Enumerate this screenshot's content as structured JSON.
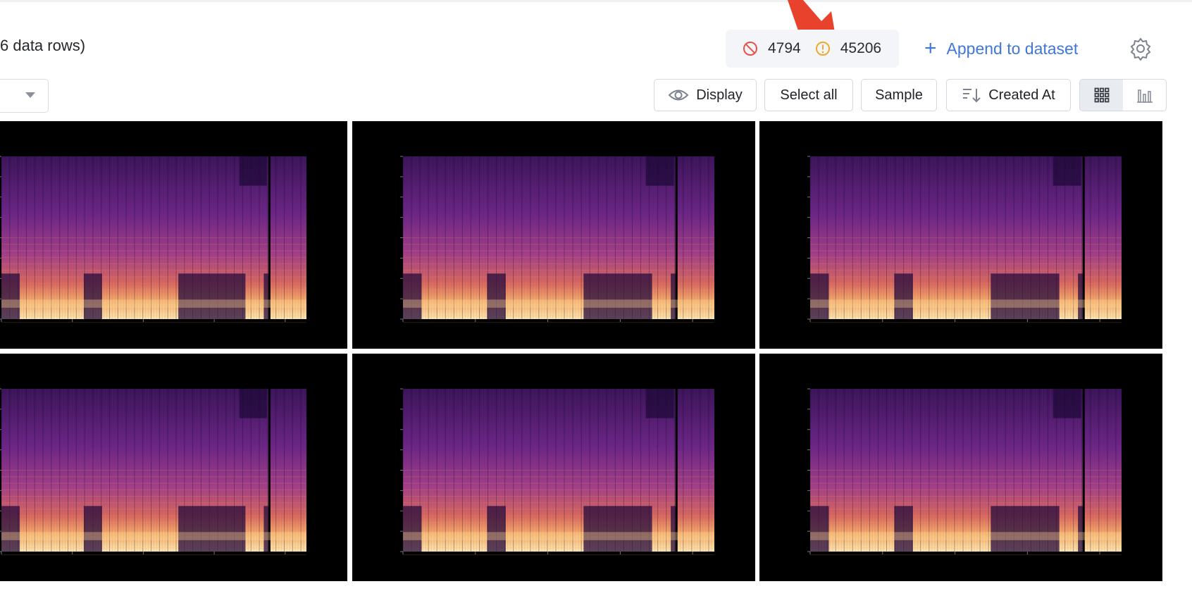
{
  "header": {
    "row_count_text": "6 data rows)"
  },
  "counts": {
    "blocked_icon": "blocked-icon",
    "blocked_count": "4794",
    "warning_icon": "warning-icon",
    "warning_count": "45206"
  },
  "actions": {
    "append_label": "Append to dataset",
    "settings_icon": "gear-icon"
  },
  "toolbar": {
    "display_label": "Display",
    "select_all_label": "Select all",
    "sample_label": "Sample",
    "sort_label": "Created At",
    "view_grid_icon": "grid-icon",
    "view_chart_icon": "bar-chart-icon"
  },
  "gallery": {
    "tiles": [
      {
        "type": "spectrogram"
      },
      {
        "type": "spectrogram"
      },
      {
        "type": "spectrogram"
      },
      {
        "type": "spectrogram"
      },
      {
        "type": "spectrogram"
      },
      {
        "type": "spectrogram"
      }
    ]
  },
  "colors": {
    "accent": "#3f78d8",
    "blocked": "#e5534b",
    "warning": "#f0a92c",
    "annotation_arrow": "#e8412c"
  }
}
